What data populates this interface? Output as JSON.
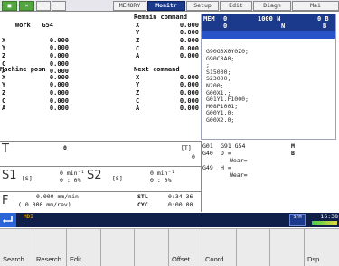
{
  "tabs": [
    {
      "label": "■",
      "state": "green"
    },
    {
      "label": "×",
      "state": "green"
    },
    {
      "label": "",
      "state": "normal"
    },
    {
      "label": "",
      "state": "normal"
    },
    {
      "label": "MEMORY",
      "state": "normal"
    },
    {
      "label": "Monitr",
      "state": "active"
    },
    {
      "label": "Setup",
      "state": "normal"
    },
    {
      "label": "Edit",
      "state": "normal"
    },
    {
      "label": "Diagn",
      "state": "normal"
    },
    {
      "label": "Mai",
      "state": "normal"
    }
  ],
  "work": {
    "title": "Work",
    "code": "G54",
    "axes": [
      {
        "axis": "X",
        "value": "0.000"
      },
      {
        "axis": "Y",
        "value": "0.000"
      },
      {
        "axis": "Z",
        "value": "0.000"
      },
      {
        "axis": "C",
        "value": "0.000"
      },
      {
        "axis": "A",
        "value": "0.000"
      }
    ]
  },
  "remain": {
    "title": "Remain command",
    "axes": [
      {
        "axis": "X",
        "value": "0.000"
      },
      {
        "axis": "Y",
        "value": "0.000"
      },
      {
        "axis": "Z",
        "value": "0.000"
      },
      {
        "axis": "C",
        "value": "0.000"
      },
      {
        "axis": "A",
        "value": "0.000"
      }
    ]
  },
  "machine": {
    "title": "Machine posn",
    "axes": [
      {
        "axis": "X",
        "value": "0.000"
      },
      {
        "axis": "Y",
        "value": "0.000"
      },
      {
        "axis": "Z",
        "value": "0.000"
      },
      {
        "axis": "C",
        "value": "0.000"
      },
      {
        "axis": "A",
        "value": "0.000"
      }
    ]
  },
  "next": {
    "title": "Next command",
    "axes": [
      {
        "axis": "X",
        "value": "0.000"
      },
      {
        "axis": "Y",
        "value": "0.000"
      },
      {
        "axis": "Z",
        "value": "0.000"
      },
      {
        "axis": "C",
        "value": "0.000"
      },
      {
        "axis": "A",
        "value": "0.000"
      }
    ]
  },
  "program": {
    "mem_label": "MEM",
    "line1_a": "0",
    "line1_b": "1000 N",
    "line1_c": "0 B",
    "line2_a": "0",
    "line2_b": "N",
    "line2_c": "B",
    "lines": [
      "G90G0X0Y0Z0;",
      "G90C0A0;",
      ";",
      "S15000;",
      "S23000;",
      "N200;",
      "G00X1.;",
      "G01Y1.F1000;",
      "M08P1001;",
      "G00Y1.0;",
      "G00X2.0;"
    ]
  },
  "tool": {
    "label": "T",
    "value": "0",
    "bracket": "[T]",
    "bracket_value": "0"
  },
  "spindle1": {
    "label": "S1",
    "unit_bracket": "[S]",
    "rpm_value": "0",
    "rpm_unit": "min⁻¹",
    "percent": "0 : 0%"
  },
  "spindle2": {
    "label": "S2",
    "unit_bracket": "[S]",
    "rpm_value": "0",
    "rpm_unit": "min⁻¹",
    "percent": "0 : 0%"
  },
  "feed": {
    "label": "F",
    "rate": "0.000 mm/min",
    "per_rev": "( 0.000  mm/rev)"
  },
  "times": [
    {
      "label": "STL",
      "value": "0:34:36"
    },
    {
      "label": "CYC",
      "value": "0:00:00"
    }
  ],
  "modal": [
    {
      "code": "G01",
      "text": "G91 G54"
    },
    {
      "code": "G40",
      "text": "D  ="
    },
    {
      "code": "",
      "text": "Wear="
    },
    {
      "code": "G49",
      "text": "H  ="
    },
    {
      "code": "",
      "text": "Wear="
    }
  ],
  "modal_right": [
    {
      "label": "M",
      "value": "B"
    }
  ],
  "status": {
    "mode": "MDI",
    "time": "16:38",
    "icon_text": "S/M"
  },
  "softkeys": [
    "Search",
    "Reserch",
    "Edit",
    "",
    "",
    "Offset",
    "Coord",
    "",
    "",
    "Dsp"
  ]
}
